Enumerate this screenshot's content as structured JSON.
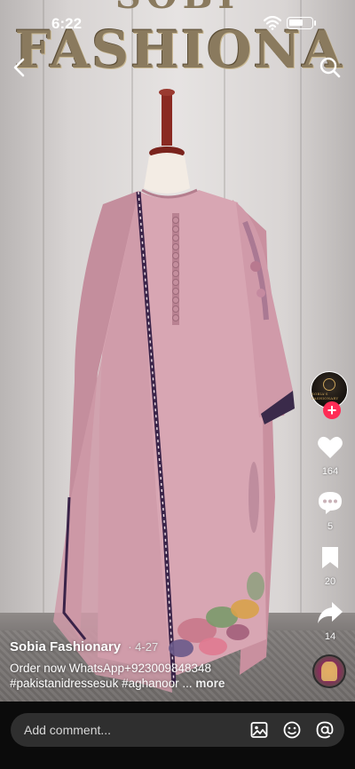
{
  "status_bar": {
    "time": "6:22"
  },
  "background_sign": {
    "text": "FASHIONA",
    "partial_top_text": "SOBI"
  },
  "rail": {
    "avatar_text": "SOBIA'S FASHIONARY",
    "likes": "164",
    "comments": "5",
    "saves": "20",
    "shares": "14"
  },
  "caption": {
    "author": "Sobia Fashionary",
    "date": "· 4-27",
    "line1": "Order now WhatsApp+923009848348",
    "line2": "#pakistanidressesuk #aghanoor ...",
    "more": "more"
  },
  "comment_bar": {
    "placeholder": "Add comment..."
  },
  "colors": {
    "accent": "#fe2c55",
    "dress": "#d8a6b3",
    "comment_bg": "#2f2f2f"
  },
  "icons": [
    "back-icon",
    "search-icon",
    "wifi-icon",
    "battery-icon",
    "heart-icon",
    "comment-icon",
    "bookmark-icon",
    "share-icon",
    "image-icon",
    "emoji-icon",
    "mention-icon"
  ]
}
